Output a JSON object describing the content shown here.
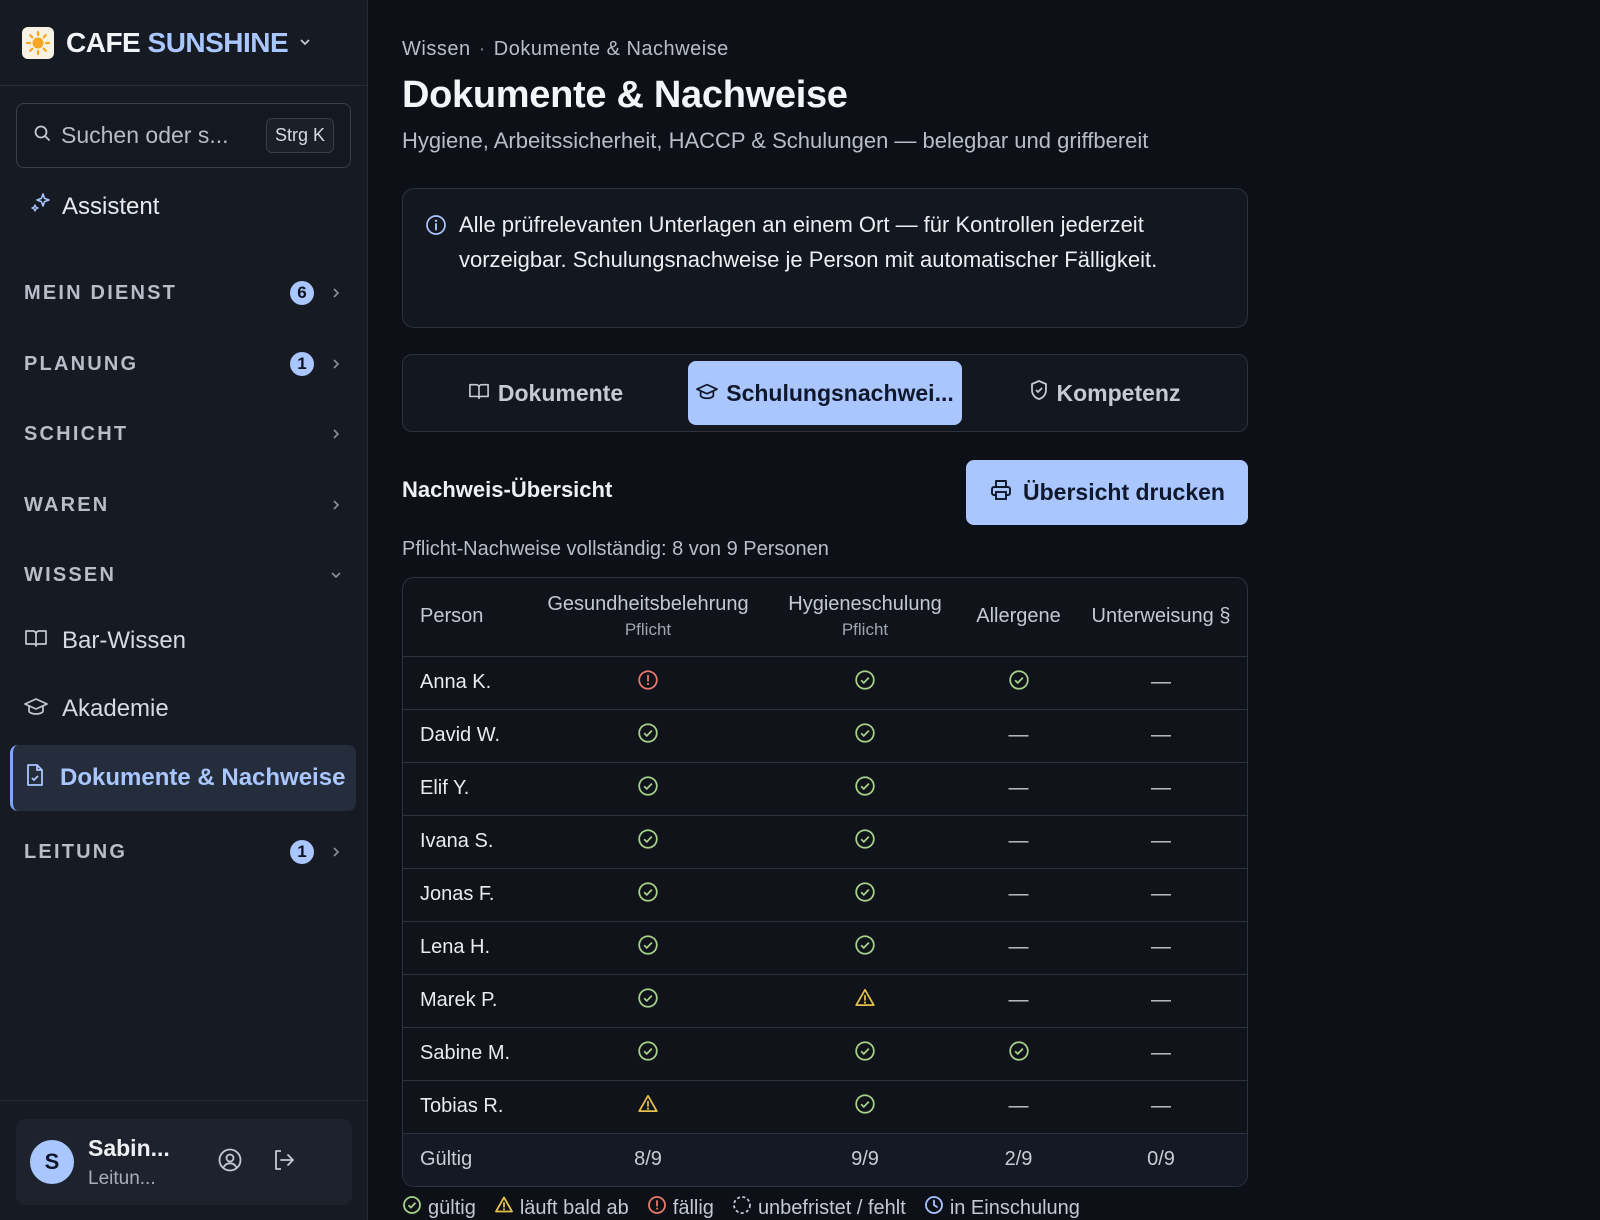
{
  "app": {
    "brand_part1": "CAFE",
    "brand_part2": "SUNSHINE",
    "logo_icon": "sun-icon"
  },
  "sidebar": {
    "search": {
      "placeholder": "Suchen oder s...",
      "shortcut": "Strg K"
    },
    "assistant_label": "Assistent",
    "sections": {
      "mein_dienst": {
        "label": "MEIN DIENST",
        "badge": "6"
      },
      "planung": {
        "label": "PLANUNG",
        "badge": "1"
      },
      "schicht": {
        "label": "SCHICHT"
      },
      "waren": {
        "label": "WAREN"
      },
      "wissen": {
        "label": "WISSEN"
      },
      "leitung": {
        "label": "LEITUNG",
        "badge": "1"
      }
    },
    "wissen_items": [
      {
        "label": "Bar-Wissen",
        "icon": "book-icon"
      },
      {
        "label": "Akademie",
        "icon": "graduation-cap-icon"
      },
      {
        "label": "Dokumente & Nachweise",
        "icon": "document-check-icon",
        "active": true
      }
    ],
    "user": {
      "initial": "S",
      "name": "Sabin...",
      "role": "Leitun..."
    }
  },
  "main": {
    "breadcrumb": [
      "Wissen",
      "Dokumente & Nachweise"
    ],
    "breadcrumb_sep": "·",
    "title": "Dokumente & Nachweise",
    "subtitle": "Hygiene, Arbeitssicherheit, HACCP & Schulungen — belegbar und griffbereit",
    "info_text": "Alle prüfrelevanten Unterlagen an einem Ort — für Kontrollen jederzeit vorzeigbar. Schulungsnachweise je Person mit automatischer Fälligkeit.",
    "tabs": [
      {
        "label": "Dokumente",
        "icon": "book-icon"
      },
      {
        "label": "Schulungsnachwei...",
        "icon": "graduation-cap-icon",
        "active": true
      },
      {
        "label": "Kompetenz",
        "icon": "shield-check-icon"
      }
    ],
    "section_title": "Nachweis-Übersicht",
    "print_label": "Übersicht drucken",
    "summary": "Pflicht-Nachweise vollständig: 8 von 9 Personen"
  },
  "table": {
    "headers": {
      "person": "Person",
      "col1": "Gesundheitsbelehrung",
      "col1_sub": "Pflicht",
      "col2": "Hygieneschulung",
      "col2_sub": "Pflicht",
      "col3": "Allergene",
      "col4": "Unterweisung §"
    },
    "rows": [
      {
        "name": "Anna K.",
        "cells": [
          "faellig",
          "gueltig",
          "gueltig",
          "none"
        ]
      },
      {
        "name": "David W.",
        "cells": [
          "gueltig",
          "gueltig",
          "none",
          "none"
        ]
      },
      {
        "name": "Elif Y.",
        "cells": [
          "gueltig",
          "gueltig",
          "none",
          "none"
        ]
      },
      {
        "name": "Ivana S.",
        "cells": [
          "gueltig",
          "gueltig",
          "none",
          "none"
        ]
      },
      {
        "name": "Jonas F.",
        "cells": [
          "gueltig",
          "gueltig",
          "none",
          "none"
        ]
      },
      {
        "name": "Lena H.",
        "cells": [
          "gueltig",
          "gueltig",
          "none",
          "none"
        ]
      },
      {
        "name": "Marek P.",
        "cells": [
          "gueltig",
          "bald",
          "none",
          "none"
        ]
      },
      {
        "name": "Sabine M.",
        "cells": [
          "gueltig",
          "gueltig",
          "gueltig",
          "none"
        ]
      },
      {
        "name": "Tobias R.",
        "cells": [
          "bald",
          "gueltig",
          "none",
          "none"
        ]
      }
    ],
    "dash": "—",
    "totals": {
      "label": "Gültig",
      "values": [
        "8/9",
        "9/9",
        "2/9",
        "0/9"
      ]
    }
  },
  "legend": [
    {
      "label": "gültig",
      "icon": "check-circle-icon"
    },
    {
      "label": "läuft bald ab",
      "icon": "warning-icon"
    },
    {
      "label": "fällig",
      "icon": "alert-circle-icon"
    },
    {
      "label": "unbefristet / fehlt",
      "icon": "dashed-circle-icon"
    },
    {
      "label": "in Einschulung",
      "icon": "clock-icon"
    }
  ],
  "colors": {
    "accent": "#a9c6ff",
    "ok": "#a6d189",
    "warn": "#e5c04c",
    "due": "#e8796b",
    "background": "#0d1017",
    "sidebar": "#161a23"
  }
}
